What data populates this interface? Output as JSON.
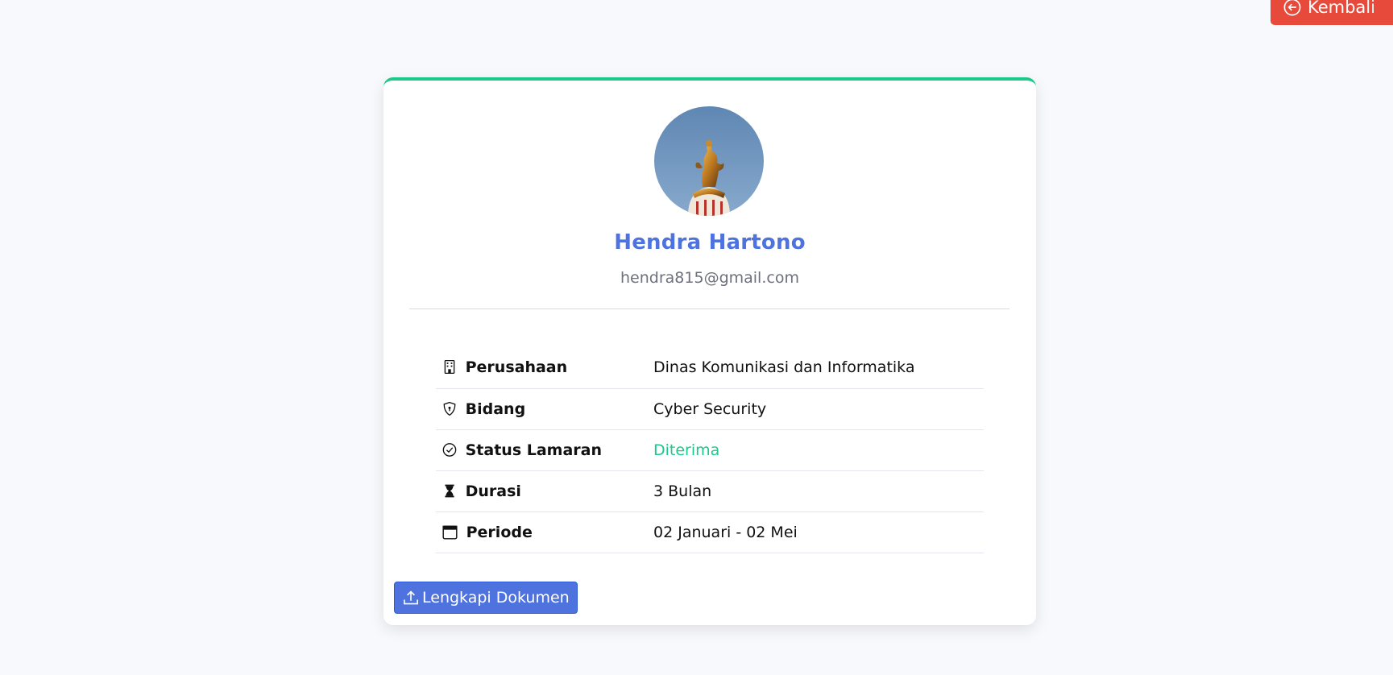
{
  "header": {
    "back_label": "Kembali"
  },
  "profile": {
    "name": "Hendra Hartono",
    "email": "hendra815@gmail.com"
  },
  "details": [
    {
      "icon": "building-icon",
      "label": "Perusahaan",
      "value": "Dinas Komunikasi dan Informatika"
    },
    {
      "icon": "shield-icon",
      "label": "Bidang",
      "value": "Cyber Security"
    },
    {
      "icon": "check-circle-icon",
      "label": "Status Lamaran",
      "value": "Diterima"
    },
    {
      "icon": "hourglass-icon",
      "label": "Durasi",
      "value": "3 Bulan"
    },
    {
      "icon": "calendar-icon",
      "label": "Periode",
      "value": "02 Januari - 02 Mei"
    }
  ],
  "actions": {
    "upload_label": "Lengkapi Dokumen"
  },
  "colors": {
    "primary": "#4e73df",
    "success": "#1cc88a",
    "danger": "#e74a3b",
    "background": "#f8f9fd"
  }
}
